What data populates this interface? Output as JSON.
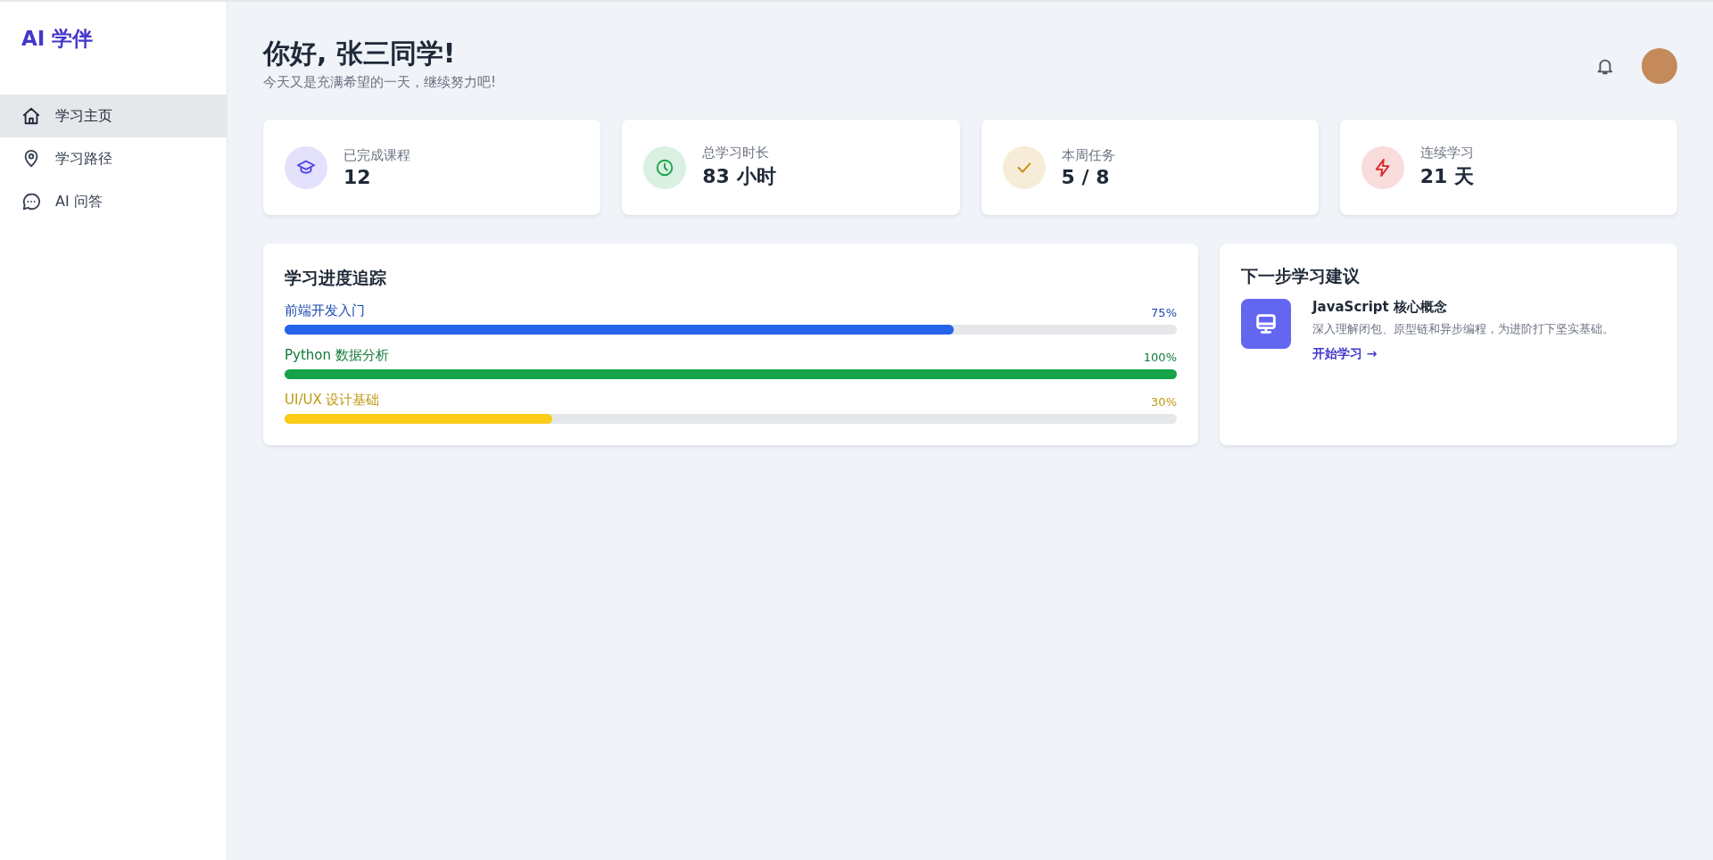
{
  "sidebar": {
    "logo": "AI 学伴",
    "items": [
      {
        "label": "学习主页",
        "kind": "home",
        "selected": true
      },
      {
        "label": "学习路径",
        "kind": "pin",
        "selected": false
      },
      {
        "label": "AI 问答",
        "kind": "chat",
        "selected": false
      }
    ]
  },
  "header": {
    "title": "你好, 张三同学!",
    "subtitle": "今天又是充满希望的一天，继续努力吧!"
  },
  "stats": [
    {
      "kind": "courses",
      "label": "已完成课程",
      "value": "12",
      "color": "#4f46e5"
    },
    {
      "kind": "time",
      "label": "总学习时长",
      "value": "83 小时",
      "color": "#16a34a"
    },
    {
      "kind": "tasks",
      "label": "本周任务",
      "value": "5 / 8",
      "color": "#ca8a04"
    },
    {
      "kind": "streak",
      "label": "连续学习",
      "value": "21 天",
      "color": "#dc2626"
    }
  ],
  "progress": {
    "title": "学习进度追踪",
    "items": [
      {
        "name": "前端开发入门",
        "percent": "75%",
        "level": 0.75,
        "color": "#2563eb"
      },
      {
        "name": "Python 数据分析",
        "percent": "100%",
        "level": 1,
        "color": "#16a34a"
      },
      {
        "name": "UI/UX 设计基础",
        "percent": "30%",
        "level": 0.3,
        "color": "#facc15"
      }
    ]
  },
  "suggestion": {
    "title": "下一步学习建议",
    "course": "JavaScript 核心概念",
    "description": "深入理解闭包、原型链和异步编程，为进阶打下坚实基础。",
    "link": "开始学习 →"
  }
}
